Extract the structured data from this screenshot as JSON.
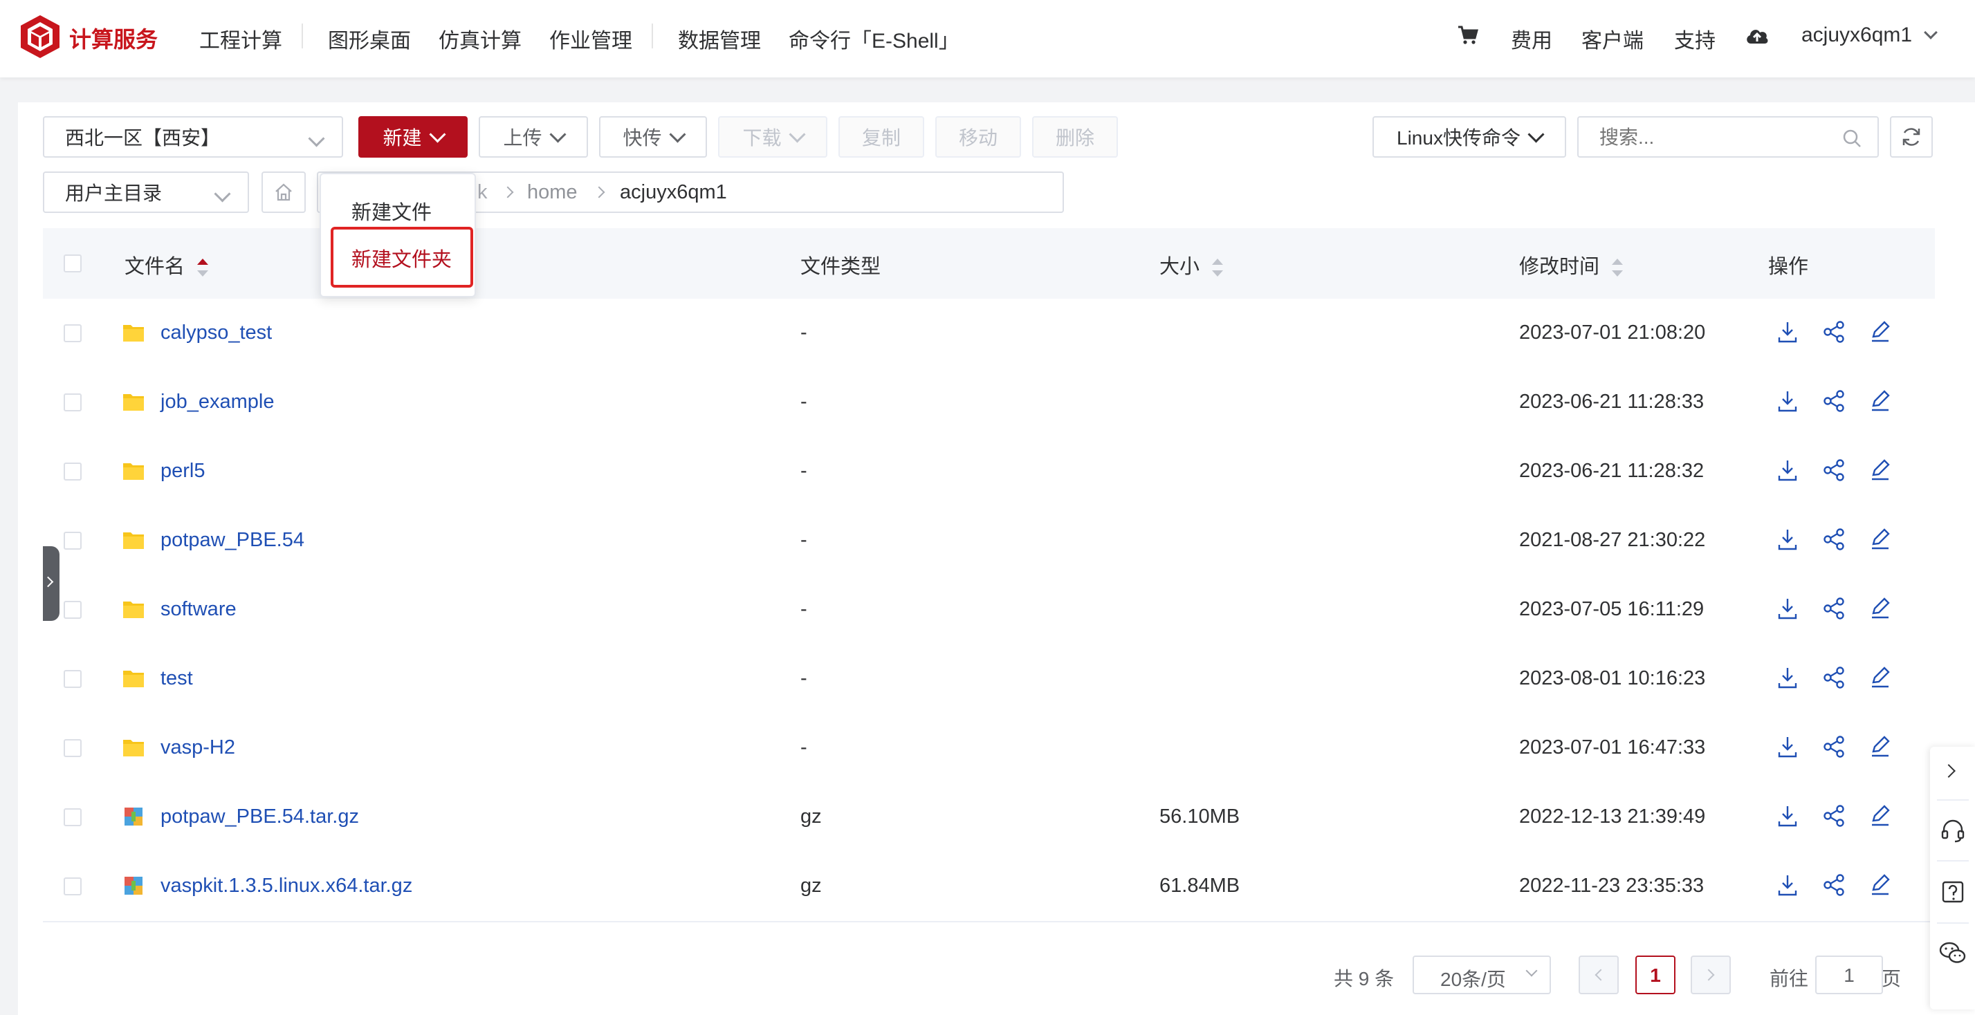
{
  "header": {
    "brand": "计算服务",
    "nav": [
      "工程计算",
      "图形桌面",
      "仿真计算",
      "作业管理",
      "数据管理",
      "命令行「E-Shell」"
    ],
    "right": {
      "fee": "费用",
      "client": "客户端",
      "support": "支持",
      "username": "acjuyx6qm1"
    }
  },
  "toolbar": {
    "region": "西北一区【西安】",
    "new": "新建",
    "upload": "上传",
    "fast": "快传",
    "download": "下载",
    "copy": "复制",
    "move": "移动",
    "delete": "删除",
    "linux_cmd": "Linux快传命令",
    "search_placeholder": "搜索..."
  },
  "path": {
    "root_select": "用户主目录",
    "crumbs": [
      "k",
      "home",
      "acjuyx6qm1"
    ]
  },
  "new_menu": {
    "items": [
      "新建文件",
      "新建文件夹"
    ],
    "highlighted": "新建文件夹"
  },
  "table": {
    "headers": {
      "name": "文件名",
      "type": "文件类型",
      "size": "大小",
      "mtime": "修改时间",
      "ops": "操作"
    },
    "rows": [
      {
        "name": "calypso_test",
        "kind": "folder",
        "type": "-",
        "size": "",
        "mtime": "2023-07-01 21:08:20"
      },
      {
        "name": "job_example",
        "kind": "folder",
        "type": "-",
        "size": "",
        "mtime": "2023-06-21 11:28:33"
      },
      {
        "name": "perl5",
        "kind": "folder",
        "type": "-",
        "size": "",
        "mtime": "2023-06-21 11:28:32"
      },
      {
        "name": "potpaw_PBE.54",
        "kind": "folder",
        "type": "-",
        "size": "",
        "mtime": "2021-08-27 21:30:22"
      },
      {
        "name": "software",
        "kind": "folder",
        "type": "-",
        "size": "",
        "mtime": "2023-07-05 16:11:29"
      },
      {
        "name": "test",
        "kind": "folder",
        "type": "-",
        "size": "",
        "mtime": "2023-08-01 10:16:23"
      },
      {
        "name": "vasp-H2",
        "kind": "folder",
        "type": "-",
        "size": "",
        "mtime": "2023-07-01 16:47:33"
      },
      {
        "name": "potpaw_PBE.54.tar.gz",
        "kind": "archive",
        "type": "gz",
        "size": "56.10MB",
        "mtime": "2022-12-13 21:39:49"
      },
      {
        "name": "vaspkit.1.3.5.linux.x64.tar.gz",
        "kind": "archive",
        "type": "gz",
        "size": "61.84MB",
        "mtime": "2022-11-23 23:35:33"
      }
    ]
  },
  "pagination": {
    "total": "共 9 条",
    "page_size": "20条/页",
    "current": "1",
    "goto_label": "前往",
    "goto_value": "1",
    "page_unit": "页"
  },
  "colors": {
    "brand": "#b3101e",
    "link": "#1f4fb4",
    "folder": "#f7c51b",
    "highlight_box": "#e02424"
  }
}
